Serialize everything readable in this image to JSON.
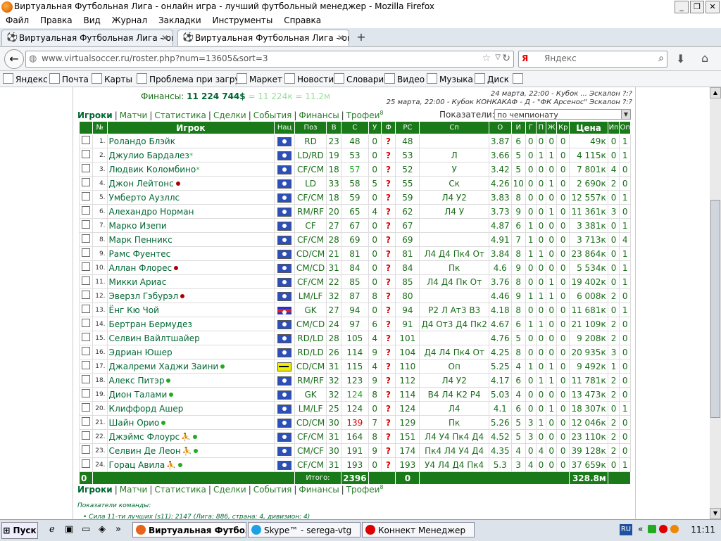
{
  "window": {
    "title": "Виртуальная Футбольная Лига - онлайн игра - лучший футбольный менеджер - Mozilla Firefox"
  },
  "menu": [
    "Файл",
    "Правка",
    "Вид",
    "Журнал",
    "Закладки",
    "Инструменты",
    "Справка"
  ],
  "tabs": [
    {
      "label": "Виртуальная Футбольная Лига - онлай...",
      "close": "✕"
    },
    {
      "label": "Виртуальная Футбольная Лига - онлай...",
      "close": "✕"
    }
  ],
  "newtab": "+",
  "nav": {
    "url": "www.virtualsoccer.ru/roster.php?num=13605&sort=3",
    "search_placeholder": "Яндекс",
    "search_engine": "Я"
  },
  "bookmarks": [
    "Яндекс",
    "Почта",
    "Карты",
    "Проблема при загру...",
    "Маркет",
    "Новости",
    "Словари",
    "Видео",
    "Музыка",
    "Диск"
  ],
  "finances": {
    "label": "Финансы:",
    "value": "11 224 744$",
    "extra": "= 11 224к = 11.2м"
  },
  "top_right": {
    "line1": "24 марта, 22:00 - Кубок ... Эскалон ?:?",
    "line2": "25 марта, 22:00 - Кубок КОНКАКАФ - Д - \"ФК Арсенос\" Эскалон ?:?"
  },
  "nav_links": [
    {
      "label": "Игроки",
      "active": true
    },
    {
      "label": "Матчи"
    },
    {
      "label": "Статистика"
    },
    {
      "label": "Сделки"
    },
    {
      "label": "События"
    },
    {
      "label": "Финансы"
    },
    {
      "label": "Трофеи",
      "sup": "8"
    }
  ],
  "indicators": {
    "label": "Показатели:",
    "selected": "по чемпионату"
  },
  "table": {
    "headers": [
      "",
      "№",
      "Игрок",
      "Нац",
      "Поз",
      "В",
      "С",
      "У",
      "Ф",
      "РС",
      "Сп",
      "О",
      "И",
      "Г",
      "П",
      "Ж",
      "Кр",
      "Цена",
      "Ип",
      "Оп"
    ],
    "rows": [
      {
        "n": "1.",
        "name": "Роландо Блэйк",
        "nat": "bz",
        "pos": "RD",
        "v": "23",
        "s": "48",
        "u": "0",
        "rs": "48",
        "sp": "",
        "o": "3.87",
        "i": "6",
        "g": "0",
        "p": "0",
        "zh": "0",
        "kr": "0",
        "price": "49к",
        "ip": "0",
        "op": "1"
      },
      {
        "n": "2.",
        "name": "Джулио Бардалез",
        "st": "star",
        "nat": "bz",
        "pos": "LD/RD",
        "v": "19",
        "s": "53",
        "u": "0",
        "rs": "53",
        "sp": "Л",
        "o": "3.66",
        "i": "5",
        "g": "0",
        "p": "1",
        "zh": "1",
        "kr": "0",
        "price": "4 115к",
        "ip": "0",
        "op": "1"
      },
      {
        "n": "3.",
        "name": "Людвик Коломбино",
        "st": "star",
        "nat": "bz",
        "pos": "CF/CM",
        "v": "18",
        "s": "57",
        "sc": "green",
        "u": "0",
        "rs": "52",
        "sp": "У",
        "o": "3.42",
        "i": "5",
        "g": "0",
        "p": "0",
        "zh": "0",
        "kr": "0",
        "price": "7 801к",
        "ip": "4",
        "op": "0"
      },
      {
        "n": "4.",
        "name": "Джон Лейтонс",
        "st": "red",
        "nat": "bz",
        "pos": "LD",
        "v": "33",
        "s": "58",
        "u": "5",
        "rs": "55",
        "sp": "Ск",
        "o": "4.26",
        "i": "10",
        "g": "0",
        "p": "0",
        "zh": "1",
        "kr": "0",
        "price": "2 690к",
        "ip": "2",
        "op": "0"
      },
      {
        "n": "5.",
        "name": "Умберто Аузллс",
        "nat": "bz",
        "pos": "CF/CM",
        "v": "18",
        "s": "59",
        "u": "0",
        "rs": "59",
        "sp": "Л4 У2",
        "o": "3.83",
        "i": "8",
        "g": "0",
        "p": "0",
        "zh": "0",
        "kr": "0",
        "price": "12 557к",
        "ip": "0",
        "op": "1"
      },
      {
        "n": "6.",
        "name": "Алехандро Норман",
        "nat": "bz",
        "pos": "RM/RF",
        "v": "20",
        "s": "65",
        "u": "4",
        "rs": "62",
        "sp": "Л4 У",
        "o": "3.73",
        "i": "9",
        "g": "0",
        "p": "0",
        "zh": "1",
        "kr": "0",
        "price": "11 361к",
        "ip": "3",
        "op": "0"
      },
      {
        "n": "7.",
        "name": "Марко Изепи",
        "nat": "bz",
        "pos": "CF",
        "v": "27",
        "s": "67",
        "u": "0",
        "rs": "67",
        "sp": "",
        "o": "4.87",
        "i": "6",
        "g": "1",
        "p": "0",
        "zh": "0",
        "kr": "0",
        "price": "3 381к",
        "ip": "0",
        "op": "1"
      },
      {
        "n": "8.",
        "name": "Марк Пенникс",
        "nat": "bz",
        "pos": "CF/CM",
        "v": "28",
        "s": "69",
        "u": "0",
        "rs": "69",
        "sp": "",
        "o": "4.91",
        "i": "7",
        "g": "1",
        "p": "0",
        "zh": "0",
        "kr": "0",
        "price": "3 713к",
        "ip": "0",
        "op": "4"
      },
      {
        "n": "9.",
        "name": "Рамс Фуентес",
        "nat": "bz",
        "pos": "CD/CM",
        "v": "21",
        "s": "81",
        "u": "0",
        "rs": "81",
        "sp": "Л4 Д4 Пк4 От",
        "o": "3.84",
        "i": "8",
        "g": "1",
        "p": "1",
        "zh": "0",
        "kr": "0",
        "price": "23 864к",
        "ip": "0",
        "op": "1"
      },
      {
        "n": "10.",
        "name": "Аллан Флорес",
        "st": "red",
        "nat": "bz",
        "pos": "CM/CD",
        "v": "31",
        "s": "84",
        "u": "0",
        "rs": "84",
        "sp": "Пк",
        "o": "4.6",
        "i": "9",
        "g": "0",
        "p": "0",
        "zh": "0",
        "kr": "0",
        "price": "5 534к",
        "ip": "0",
        "op": "1"
      },
      {
        "n": "11.",
        "name": "Микки Ариас",
        "nat": "bz",
        "pos": "CF/CM",
        "v": "22",
        "s": "85",
        "u": "0",
        "rs": "85",
        "sp": "Л4 Д4 Пк От",
        "o": "3.76",
        "i": "8",
        "g": "0",
        "p": "0",
        "zh": "1",
        "kr": "0",
        "price": "19 402к",
        "ip": "0",
        "op": "1"
      },
      {
        "n": "12.",
        "name": "Эверзл Гэбурэл",
        "st": "red",
        "nat": "bz",
        "pos": "LM/LF",
        "v": "32",
        "s": "87",
        "u": "8",
        "rs": "80",
        "sp": "",
        "o": "4.46",
        "i": "9",
        "g": "1",
        "p": "1",
        "zh": "1",
        "kr": "0",
        "price": "6 008к",
        "ip": "2",
        "op": "0"
      },
      {
        "n": "13.",
        "name": "Ёнг Кю Чой",
        "nat": "nk",
        "pos": "GK",
        "v": "27",
        "s": "94",
        "u": "0",
        "rs": "94",
        "sp": "Р2 Л Ат3 В3",
        "o": "4.18",
        "i": "8",
        "g": "0",
        "p": "0",
        "zh": "0",
        "kr": "0",
        "price": "11 681к",
        "ip": "0",
        "op": "1"
      },
      {
        "n": "14.",
        "name": "Бертран Бермудез",
        "nat": "bz",
        "pos": "CM/CD",
        "v": "24",
        "s": "97",
        "u": "6",
        "rs": "91",
        "sp": "Д4 От3 Д4 Пк2",
        "o": "4.67",
        "i": "6",
        "g": "1",
        "p": "1",
        "zh": "0",
        "kr": "0",
        "price": "21 109к",
        "ip": "2",
        "op": "0"
      },
      {
        "n": "15.",
        "name": "Селвин Вайлтшайер",
        "nat": "bz",
        "pos": "RD/LD",
        "v": "28",
        "s": "105",
        "u": "4",
        "rs": "101",
        "sp": "",
        "o": "4.76",
        "i": "5",
        "g": "0",
        "p": "0",
        "zh": "0",
        "kr": "0",
        "price": "9 208к",
        "ip": "2",
        "op": "0"
      },
      {
        "n": "16.",
        "name": "Эдриан Юшер",
        "nat": "bz",
        "pos": "RD/LD",
        "v": "26",
        "s": "114",
        "u": "9",
        "rs": "104",
        "sp": "Д4 Л4 Пк4 От",
        "o": "4.25",
        "i": "8",
        "g": "0",
        "p": "0",
        "zh": "0",
        "kr": "0",
        "price": "20 935к",
        "ip": "3",
        "op": "0"
      },
      {
        "n": "17.",
        "name": "Джалреми Хаджи Заини",
        "st": "grn",
        "nat": "bn",
        "pos": "CD/CM",
        "v": "31",
        "s": "115",
        "u": "4",
        "rs": "110",
        "sp": "Оп",
        "o": "5.25",
        "i": "4",
        "g": "1",
        "p": "0",
        "zh": "1",
        "kr": "0",
        "price": "9 492к",
        "ip": "1",
        "op": "0"
      },
      {
        "n": "18.",
        "name": "Алекс Питэр",
        "st": "grn",
        "nat": "bz",
        "pos": "RM/RF",
        "v": "32",
        "s": "123",
        "u": "9",
        "rs": "112",
        "sp": "Л4 У2",
        "o": "4.17",
        "i": "6",
        "g": "0",
        "p": "1",
        "zh": "1",
        "kr": "0",
        "price": "11 781к",
        "ip": "2",
        "op": "0"
      },
      {
        "n": "19.",
        "name": "Дион Талами",
        "st": "grn",
        "nat": "bz",
        "pos": "GK",
        "v": "32",
        "s": "124",
        "sc": "green",
        "u": "8",
        "rs": "114",
        "sp": "В4 Л4 К2 Р4",
        "o": "5.03",
        "i": "4",
        "g": "0",
        "p": "0",
        "zh": "0",
        "kr": "0",
        "price": "13 473к",
        "ip": "2",
        "op": "0"
      },
      {
        "n": "20.",
        "name": "Клиффорд Ашер",
        "nat": "bz",
        "pos": "LM/LF",
        "v": "25",
        "s": "124",
        "u": "0",
        "rs": "124",
        "sp": "Л4",
        "o": "4.1",
        "i": "6",
        "g": "0",
        "p": "0",
        "zh": "1",
        "kr": "0",
        "price": "18 307к",
        "ip": "0",
        "op": "1"
      },
      {
        "n": "21.",
        "name": "Шайн Орио",
        "st": "grn",
        "nat": "bz",
        "pos": "CD/CM",
        "v": "30",
        "s": "139",
        "sc": "red",
        "u": "7",
        "rs": "129",
        "sp": "Пк",
        "o": "5.26",
        "i": "5",
        "g": "3",
        "p": "1",
        "zh": "0",
        "kr": "0",
        "price": "12 046к",
        "ip": "2",
        "op": "0"
      },
      {
        "n": "22.",
        "name": "Джэймс Флоурс",
        "st": "fig",
        "nat": "bz",
        "pos": "CF/CM",
        "v": "31",
        "s": "164",
        "u": "8",
        "rs": "151",
        "sp": "Л4 У4 Пк4 Д4",
        "o": "4.52",
        "i": "5",
        "g": "3",
        "p": "0",
        "zh": "0",
        "kr": "0",
        "price": "23 110к",
        "ip": "2",
        "op": "0"
      },
      {
        "n": "23.",
        "name": "Селвин Де Леон",
        "st": "fig",
        "nat": "bz",
        "pos": "CM/CF",
        "v": "30",
        "s": "191",
        "u": "9",
        "rs": "174",
        "sp": "Пк4 Л4 У4 Д4",
        "o": "4.35",
        "i": "4",
        "g": "0",
        "p": "4",
        "zh": "0",
        "kr": "0",
        "price": "39 128к",
        "ip": "2",
        "op": "0"
      },
      {
        "n": "24.",
        "name": "Горац Авила",
        "st": "fig",
        "nat": "bz",
        "pos": "CF/CM",
        "v": "31",
        "s": "193",
        "u": "0",
        "rs": "193",
        "sp": "У4 Л4 Д4 Пк4",
        "o": "5.3",
        "i": "3",
        "g": "4",
        "p": "0",
        "zh": "0",
        "kr": "0",
        "price": "37 659к",
        "ip": "0",
        "op": "1"
      }
    ],
    "total": {
      "zero": "0",
      "label": "Итого:",
      "s": "2396",
      "u": "0",
      "price": "328.8м"
    }
  },
  "team": {
    "header": "Показатели команды:",
    "line": "Сила 11-ти лучших (s11): 2147 (Лига: 886, страна: 4, дивизион: 4)"
  },
  "taskbar": {
    "start": "Пуск",
    "tasks": [
      "Виртуальная Футбол...",
      "Skype™ - serega-vtg",
      "Коннект Менеджер"
    ],
    "lang": "RU",
    "time": "11:11"
  }
}
